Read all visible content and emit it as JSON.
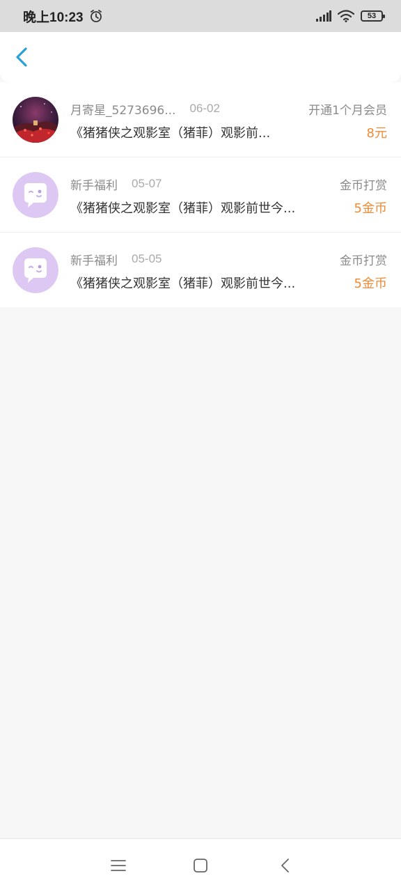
{
  "status_bar": {
    "time": "晚上10:23",
    "battery": "53",
    "icons": [
      "alarm-icon",
      "signal-icon",
      "wifi-icon",
      "battery-icon"
    ]
  },
  "header": {
    "back_icon": "chevron-left-icon",
    "accent_color": "#2a9fd8"
  },
  "records": [
    {
      "avatar": "night-scene-avatar",
      "username": "月寄星_5273696...",
      "date": "06-02",
      "type": "开通1个月会员",
      "title": "《猪猪侠之观影室（猪菲）观影前...",
      "amount": "8元"
    },
    {
      "avatar": "chat-bubble-avatar",
      "username": "新手福利",
      "date": "05-07",
      "type": "金币打赏",
      "title": "《猪猪侠之观影室（猪菲）观影前世今...",
      "amount": "5金币"
    },
    {
      "avatar": "chat-bubble-avatar",
      "username": "新手福利",
      "date": "05-05",
      "type": "金币打赏",
      "title": "《猪猪侠之观影室（猪菲）观影前世今...",
      "amount": "5金币"
    }
  ],
  "colors": {
    "amount": "#ef8a37",
    "avatar_purple": "#dcc8f2"
  },
  "nav_bar": [
    "menu-icon",
    "home-square-icon",
    "back-chevron-icon"
  ]
}
